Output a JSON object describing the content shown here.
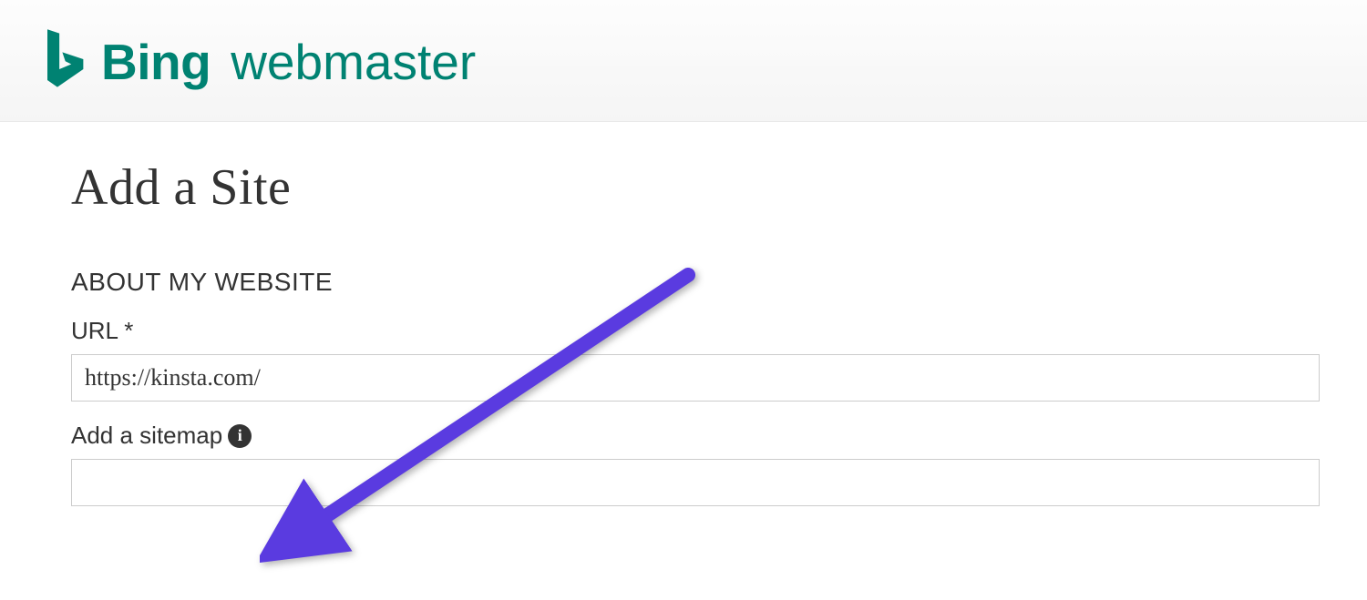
{
  "header": {
    "brand_bing": "Bing",
    "brand_webmaster": "webmaster"
  },
  "page": {
    "title": "Add a Site"
  },
  "form": {
    "section_label": "ABOUT MY WEBSITE",
    "url_label": "URL *",
    "url_value": "https://kinsta.com/",
    "sitemap_label": "Add a sitemap",
    "sitemap_value": "",
    "info_icon_text": "i"
  },
  "annotation": {
    "arrow_color": "#5a3be0"
  }
}
